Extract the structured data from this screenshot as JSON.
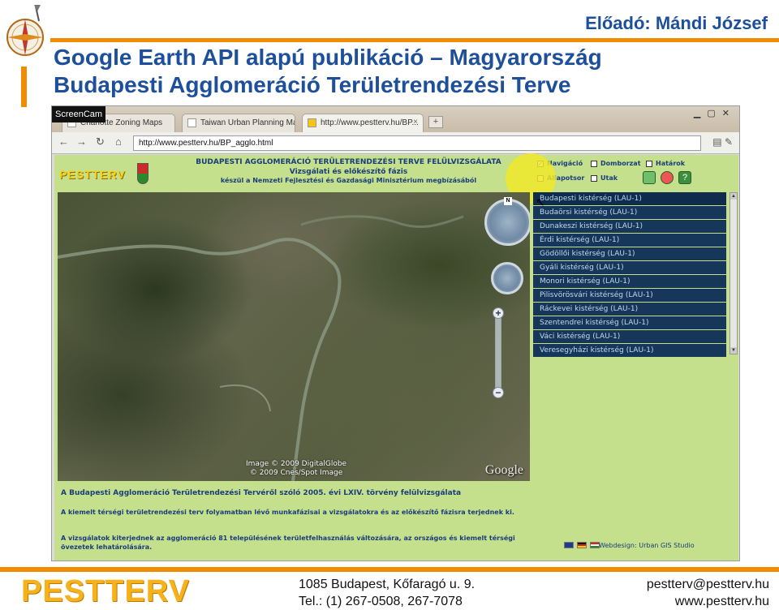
{
  "slide": {
    "presenter": "Előadó: Mándi József",
    "title_line1": "Google Earth API alapú publikáció – Magyarország",
    "title_line2": "Budapesti Agglomeráció Területrendezési Terve",
    "accent_color": "#f08c00",
    "title_color": "#1d4f9a",
    "footer": {
      "logo": "PESTTERV",
      "address": "1085 Budapest, Kőfaragó u. 9.",
      "phone": "Tel.: (1) 267-0508, 267-7078",
      "email": "pestterv@pestterv.hu",
      "website": "www.pestterv.hu"
    }
  },
  "recorder_badge": "ScreenCam",
  "browser": {
    "tabs": [
      {
        "label": "Charlotte Zoning Maps"
      },
      {
        "label": "Taiwan Urban Planning Ma..."
      },
      {
        "label": "http://www.pestterv.hu/BP..."
      }
    ],
    "new_tab": "+",
    "url": "http://www.pestterv.hu/BP_agglo.html",
    "nav": {
      "back": "←",
      "forward": "→",
      "reload": "↻",
      "home": "⌂"
    }
  },
  "page": {
    "logo": "PESTTERV",
    "heading_line1": "BUDAPESTI AGGLOMERÁCIÓ TERÜLETRENDEZÉSI TERVE FELÜLVIZSGÁLATA",
    "heading_line2": "Vizsgálati és előkészítő fázis",
    "heading_line3": "készül a Nemzeti Fejlesztési és Gazdasági Minisztérium megbízásából",
    "checkboxes": [
      {
        "label": "Navigáció",
        "checked": true
      },
      {
        "label": "Domborzat",
        "checked": false
      },
      {
        "label": "Határok",
        "checked": false
      },
      {
        "label": "Állapotsor",
        "checked": false
      },
      {
        "label": "Utak",
        "checked": false
      }
    ],
    "map": {
      "credit_line1": "Image © 2009 DigitalGlobe",
      "credit_line2": "© 2009 Cnes/Spot Image",
      "google": "Google",
      "north": "N",
      "zoom_in": "+",
      "zoom_out": "−"
    },
    "regions": [
      "Budapesti kistérség (LAU-1)",
      "Budaörsi kistérség (LAU-1)",
      "Dunakeszi kistérség (LAU-1)",
      "Érdi kistérség (LAU-1)",
      "Gödöllői kistérség (LAU-1)",
      "Gyáli kistérség (LAU-1)",
      "Monori kistérség (LAU-1)",
      "Pilisvörösvári kistérség (LAU-1)",
      "Ráckevei kistérség (LAU-1)",
      "Szentendrei kistérség (LAU-1)",
      "Váci kistérség (LAU-1)",
      "Veresegyházi kistérség (LAU-1)"
    ],
    "info_line1": "A Budapesti Agglomeráció Területrendezési Tervéről szóló 2005. évi LXIV. törvény felülvizsgálata",
    "info_line2": "A kiemelt térségi területrendezési terv folyamatban lévő munkafázisai a vizsgálatokra és az előkészítő fázisra terjednek ki.",
    "info_line3": "A vizsgálatok kiterjednek az agglomeráció 81 településének területfelhasználás változására, az országos és kiemelt térségi övezetek lehatárolására.",
    "webdesign": "Webdesign: Urban GIS Studio"
  }
}
